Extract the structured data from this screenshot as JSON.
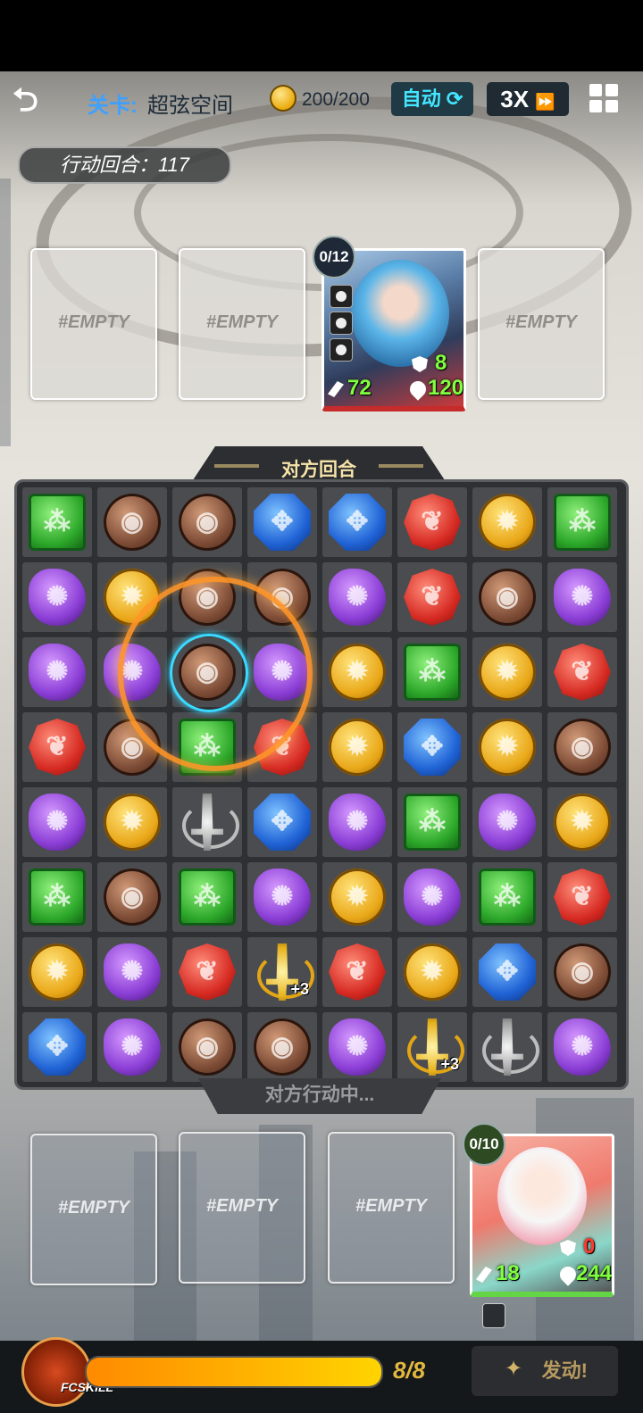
{
  "header": {
    "stage_label": "关卡:",
    "stage_name": "超弦空间",
    "coins": "200/200",
    "auto_label": "自动",
    "speed_label": "3X"
  },
  "turn_counter": "行动回合：117",
  "enemy": {
    "slots": [
      "#EMPTY",
      "#EMPTY",
      "#EMPTY"
    ],
    "card": {
      "counter": "0/12",
      "shield": "8",
      "attack": "72",
      "hp": "120"
    }
  },
  "banner": "对方回合",
  "status_message": "对方行动中...",
  "player": {
    "slots": [
      "#EMPTY",
      "#EMPTY",
      "#EMPTY"
    ],
    "card": {
      "counter": "0/10",
      "shield": "0",
      "attack": "18",
      "hp": "244"
    }
  },
  "board": {
    "rows": [
      [
        "green",
        "brown",
        "brown",
        "blue",
        "blue",
        "red",
        "gold",
        "green"
      ],
      [
        "purple",
        "gold",
        "brown",
        "brown",
        "purple",
        "red",
        "brown",
        "purple"
      ],
      [
        "purple",
        "purple",
        "brown",
        "purple",
        "gold",
        "green",
        "gold",
        "red"
      ],
      [
        "red",
        "brown",
        "green",
        "red",
        "gold",
        "blue",
        "gold",
        "brown"
      ],
      [
        "purple",
        "gold",
        "sword-silver",
        "blue",
        "purple",
        "green",
        "purple",
        "gold"
      ],
      [
        "green",
        "brown",
        "green",
        "purple",
        "gold",
        "purple",
        "green",
        "red"
      ],
      [
        "gold",
        "purple",
        "red",
        "sword-gold",
        "red",
        "gold",
        "blue",
        "brown"
      ],
      [
        "blue",
        "purple",
        "brown",
        "brown",
        "purple",
        "sword-gold",
        "sword-silver",
        "purple"
      ]
    ],
    "bonus_label": "+3"
  },
  "skill_bar": {
    "logo_text": "FCSKILL",
    "energy": "8/8",
    "energy_fraction": 1.0,
    "launch_label": "发动!"
  },
  "colors": {
    "accent_cyan": "#43e6ff",
    "energy_gold": "#e3b73e",
    "hp_green": "#7fff3d",
    "shield_red": "#ff3a2f"
  }
}
